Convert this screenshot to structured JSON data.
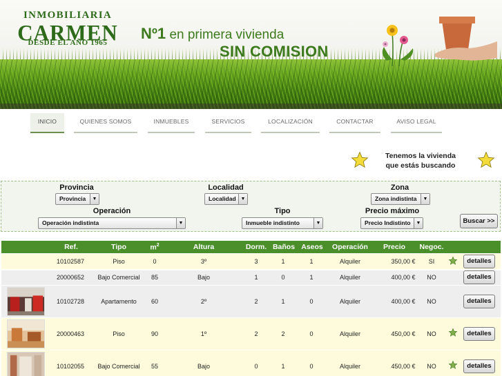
{
  "header": {
    "logo_top": "INMOBILIARIA",
    "logo_main": "CARMEN",
    "logo_sub": "DESDE EL AÑO 1965",
    "slogan_line1_strong": "Nº1",
    "slogan_line1_rest": " en primera vivienda",
    "slogan_line2": "SIN COMISION"
  },
  "nav": {
    "items": [
      {
        "label": "INICIO",
        "active": true
      },
      {
        "label": "QUIENES SOMOS"
      },
      {
        "label": "INMUEBLES"
      },
      {
        "label": "SERVICIOS"
      },
      {
        "label": "LOCALIZACIÓN"
      },
      {
        "label": "CONTACTAR"
      },
      {
        "label": "AVISO LEGAL"
      }
    ]
  },
  "promo": {
    "line1": "Tenemos la vivienda",
    "line2": "que estás buscando"
  },
  "search": {
    "provincia_label": "Provincia",
    "provincia_value": "Provincia",
    "localidad_label": "Localidad",
    "localidad_value": "Localidad",
    "zona_label": "Zona",
    "zona_value": "Zona indistinta",
    "operacion_label": "Operación",
    "operacion_value": "Operación indistinta",
    "tipo_label": "Tipo",
    "tipo_value": "Inmueble indistinto",
    "precio_label": "Precio máximo",
    "precio_value": "Precio Indistinto",
    "submit_label": "Buscar >>"
  },
  "table": {
    "headers": {
      "ref": "Ref.",
      "tipo": "Tipo",
      "m2": "m",
      "m2_sup": "2",
      "altura": "Altura",
      "dorm": "Dorm.",
      "banos": "Baños",
      "aseos": "Aseos",
      "operacion": "Operación",
      "precio": "Precio",
      "negoc": "Negoc."
    },
    "details_label": "detalles",
    "rows": [
      {
        "ref": "10102587",
        "tipo": "Piso",
        "m2": "0",
        "altura": "3º",
        "dorm": "3",
        "banos": "1",
        "aseos": "1",
        "operacion": "Alquiler",
        "precio": "350,00 €",
        "negoc": "SI",
        "star": true,
        "photo": null
      },
      {
        "ref": "20000652",
        "tipo": "Bajo Comercial",
        "m2": "85",
        "altura": "Bajo",
        "dorm": "1",
        "banos": "0",
        "aseos": "1",
        "operacion": "Alquiler",
        "precio": "400,00 €",
        "negoc": "NO",
        "star": false,
        "photo": null
      },
      {
        "ref": "10102728",
        "tipo": "Apartamento",
        "m2": "60",
        "altura": "2º",
        "dorm": "2",
        "banos": "1",
        "aseos": "0",
        "operacion": "Alquiler",
        "precio": "400,00 €",
        "negoc": "NO",
        "star": false,
        "photo": "red-interior"
      },
      {
        "ref": "20000463",
        "tipo": "Piso",
        "m2": "90",
        "altura": "1º",
        "dorm": "2",
        "banos": "2",
        "aseos": "0",
        "operacion": "Alquiler",
        "precio": "450,00 €",
        "negoc": "NO",
        "star": true,
        "photo": "orange-room"
      },
      {
        "ref": "10102055",
        "tipo": "Bajo Comercial",
        "m2": "55",
        "altura": "Bajo",
        "dorm": "0",
        "banos": "1",
        "aseos": "0",
        "operacion": "Alquiler",
        "precio": "450,00 €",
        "negoc": "NO",
        "star": true,
        "photo": "empty-room"
      }
    ]
  },
  "colors": {
    "brand_green": "#2d6b1a",
    "table_header": "#4a8f2a",
    "row_highlight": "#fdfbdc",
    "row_plain": "#eeeeee"
  }
}
